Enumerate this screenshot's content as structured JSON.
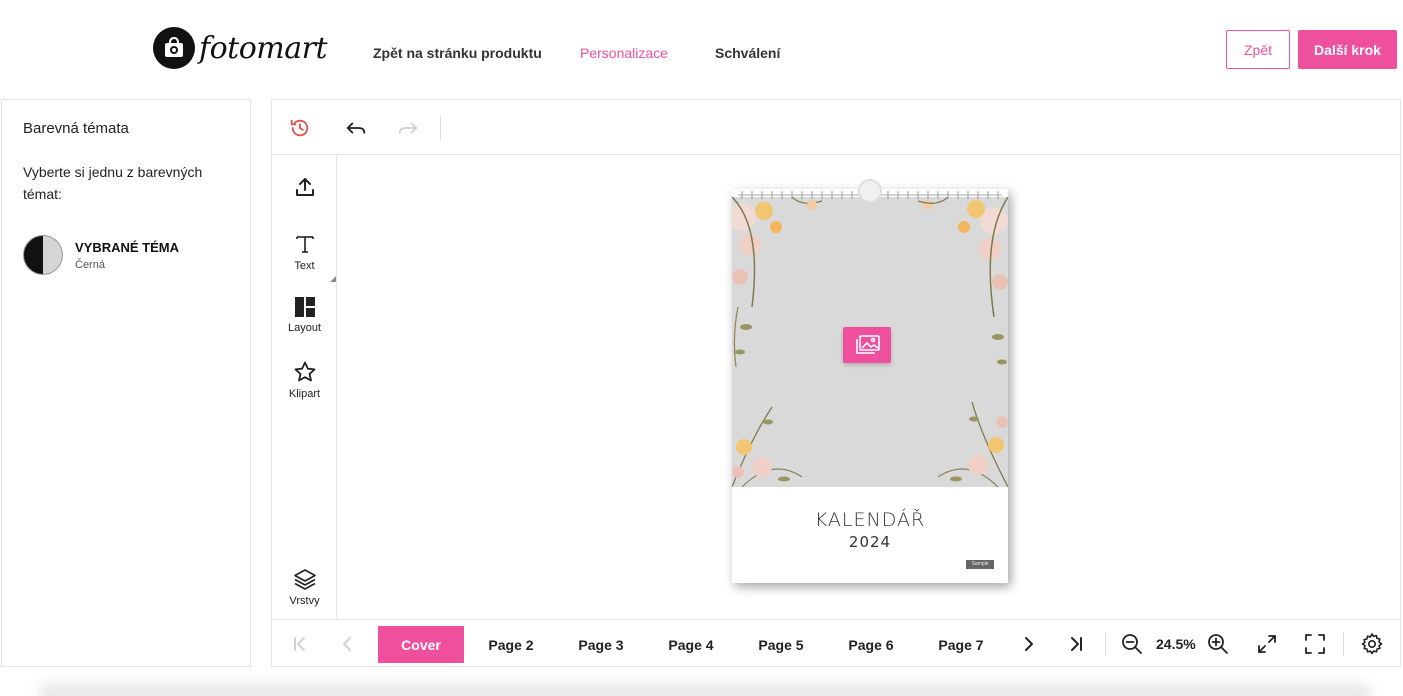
{
  "header": {
    "logo_text": "fotomart",
    "nav": [
      {
        "label": "Zpět na stránku produktu"
      },
      {
        "label": "Personalizace"
      },
      {
        "label": "Schválení"
      }
    ],
    "back_label": "Zpět",
    "next_label": "Další krok"
  },
  "left_panel": {
    "title": "Barevná témata",
    "description": "Vyberte si jednu z barevných témat:",
    "theme_name": "VYBRANÉ TÉMA",
    "theme_color": "Černá"
  },
  "toolbar": {
    "text_label": "Text",
    "layout_label": "Layout",
    "clipart_label": "Klipart",
    "layers_label": "Vrstvy"
  },
  "calendar": {
    "title": "KALENDÁŘ",
    "year": "2024",
    "stamp": "Sample"
  },
  "pages": [
    {
      "label": "Cover"
    },
    {
      "label": "Page 2"
    },
    {
      "label": "Page 3"
    },
    {
      "label": "Page 4"
    },
    {
      "label": "Page 5"
    },
    {
      "label": "Page 6"
    },
    {
      "label": "Page 7"
    }
  ],
  "zoom": "24.5%",
  "colors": {
    "accent": "#ee509d",
    "history_icon": "#e0524a"
  }
}
